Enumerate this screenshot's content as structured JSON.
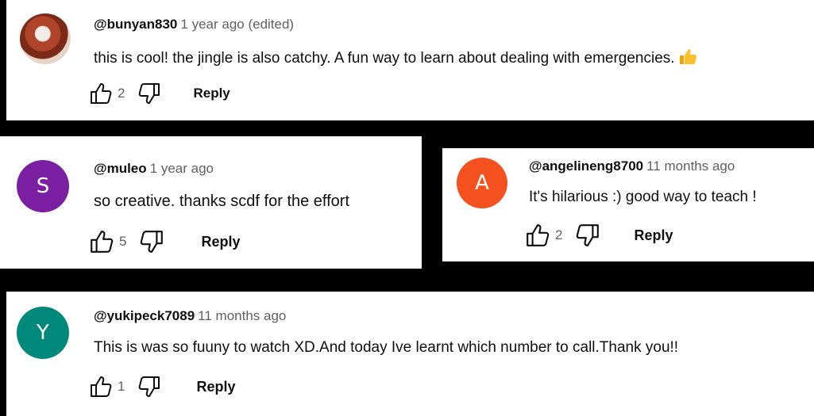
{
  "comments": [
    {
      "handle": "@bunyan830",
      "time": "1 year ago (edited)",
      "text": "this is cool! the jingle is also catchy. A fun way to learn about dealing with emergencies.",
      "emoji_icon": "thumbs-up-emoji",
      "likes": "2",
      "reply_label": "Reply",
      "avatar": {
        "type": "photo"
      }
    },
    {
      "handle": "@muleo",
      "time": "1 year ago",
      "text": "so creative. thanks scdf for the effort",
      "likes": "5",
      "reply_label": "Reply",
      "avatar": {
        "letter": "S",
        "color": "#7b1fa2"
      }
    },
    {
      "handle": "@angelineng8700",
      "time": "11 months ago",
      "text": "It's hilarious :) good way to teach !",
      "likes": "2",
      "reply_label": "Reply",
      "avatar": {
        "letter": "A",
        "color": "#f4511e"
      }
    },
    {
      "handle": "@yukipeck7089",
      "time": "11 months ago",
      "text": "This is was so fuuny to watch XD.And today Ive learnt which number to call.Thank you!!",
      "likes": "1",
      "reply_label": "Reply",
      "avatar": {
        "letter": "Y",
        "color": "#00897b"
      }
    }
  ]
}
